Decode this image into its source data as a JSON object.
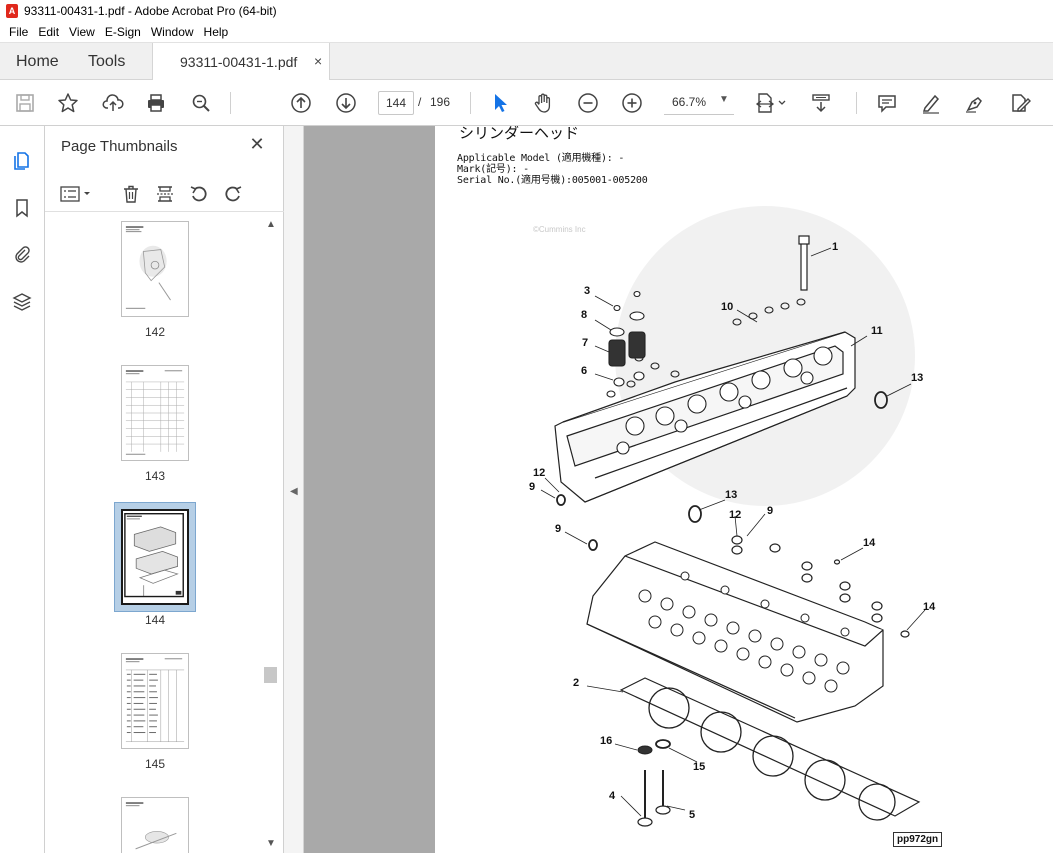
{
  "window": {
    "title": "93311-00431-1.pdf - Adobe Acrobat Pro (64-bit)"
  },
  "menu": {
    "items": [
      "File",
      "Edit",
      "View",
      "E-Sign",
      "Window",
      "Help"
    ]
  },
  "tabs": {
    "home": "Home",
    "tools": "Tools",
    "document": "93311-00431-1.pdf",
    "close_glyph": "×"
  },
  "toolbar": {
    "current_page": "144",
    "page_separator": "/",
    "total_pages": "196",
    "zoom": "66.7%",
    "icons": [
      "save-icon",
      "bookmark-star-icon",
      "upload-icon",
      "print-icon",
      "search-zoom-icon",
      "prev-page-icon",
      "next-page-icon",
      "select-cursor-icon",
      "hand-icon",
      "zoom-out-icon",
      "zoom-in-icon",
      "page-fit-icon",
      "scroll-mode-icon",
      "comment-icon",
      "highlight-icon",
      "sign-icon",
      "edit-pdf-icon"
    ]
  },
  "thumbnail_panel": {
    "title": "Page Thumbnails",
    "close_glyph": "✕",
    "thumbnails": [
      {
        "label": "142",
        "selected": false
      },
      {
        "label": "143",
        "selected": false
      },
      {
        "label": "144",
        "selected": true
      },
      {
        "label": "145",
        "selected": false
      },
      {
        "label": "",
        "selected": false
      }
    ]
  },
  "document": {
    "heading": "シリンダーヘッド",
    "meta_lines": [
      "Applicable Model (適用機種): -",
      "Mark(記号): -",
      "Serial No.(適用号機):005001-005200"
    ],
    "watermark": "©Cummins Inc",
    "figure_code": "pp972gn",
    "callouts": [
      "1",
      "3",
      "8",
      "7",
      "6",
      "10",
      "11",
      "13",
      "12",
      "9",
      "13",
      "12",
      "9",
      "9",
      "14",
      "14",
      "2",
      "16",
      "15",
      "4",
      "5"
    ]
  },
  "colors": {
    "accent_blue": "#1473e6",
    "doc_background": "#a9a9a9",
    "selection_bg": "#b6cfe6",
    "acrobat_red": "#e0281c"
  }
}
